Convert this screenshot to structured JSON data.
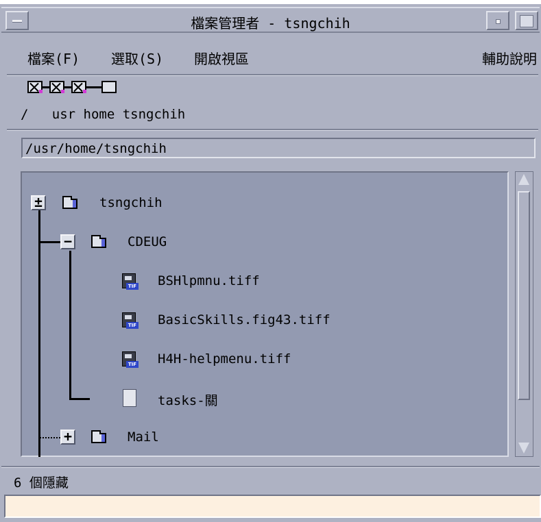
{
  "window": {
    "title": "檔案管理者 - tsngchih"
  },
  "menubar": {
    "file": "檔案(F)",
    "select": "選取(S)",
    "view": "開啟視區",
    "help": "輔助說明"
  },
  "path_labels": "/   usr home tsngchih",
  "address": {
    "value": "/usr/home/tsngchih"
  },
  "tree": {
    "root": {
      "label": "tsngchih",
      "toggle": "±"
    },
    "cdeug": {
      "label": "CDEUG",
      "toggle": "−"
    },
    "files": [
      {
        "label": "BSHlpmnu.tiff",
        "icon": "tiff-image-icon"
      },
      {
        "label": "BasicSkills.fig43.tiff",
        "icon": "tiff-image-icon"
      },
      {
        "label": "H4H-helpmenu.tiff",
        "icon": "tiff-image-icon"
      },
      {
        "label": "tasks-關",
        "icon": "document-icon"
      }
    ],
    "mail": {
      "label": "Mail",
      "toggle": "+"
    }
  },
  "status": {
    "text": "6 個隱藏"
  },
  "colors": {
    "window_bg": "#aeb2c3",
    "tree_bg": "#939ab1",
    "message_bg": "#fdf0e0"
  }
}
